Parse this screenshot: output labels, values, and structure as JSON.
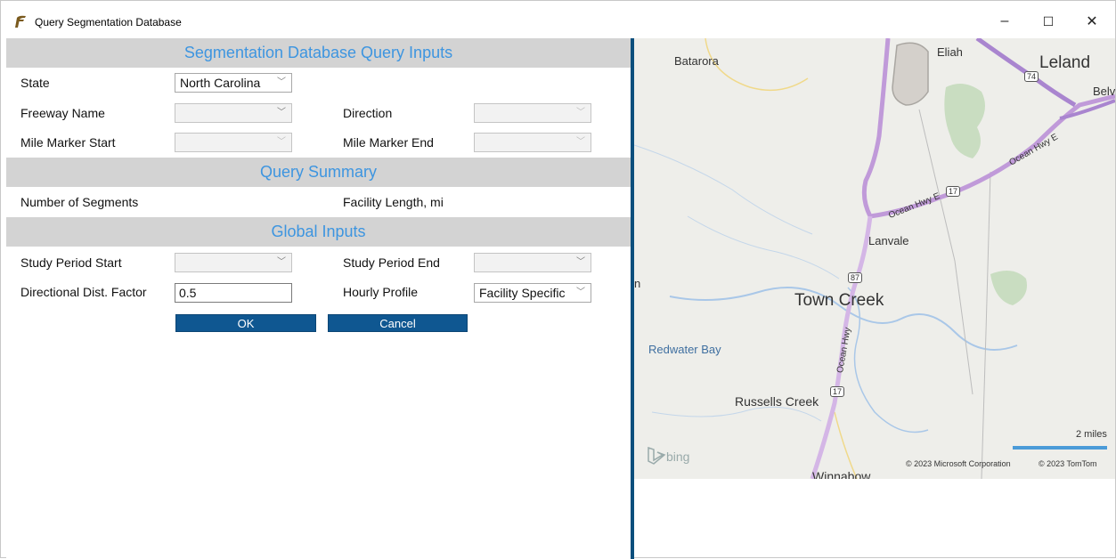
{
  "window": {
    "title": "Query Segmentation Database",
    "minimize": "–",
    "maximize": "☐",
    "close": "✕"
  },
  "sections": {
    "inputs": "Segmentation Database Query Inputs",
    "summary": "Query Summary",
    "global": "Global Inputs"
  },
  "fields": {
    "state_label": "State",
    "state_value": "North Carolina",
    "freeway_label": "Freeway Name",
    "freeway_value": "",
    "direction_label": "Direction",
    "direction_value": "",
    "mm_start_label": "Mile Marker Start",
    "mm_start_value": "",
    "mm_end_label": "Mile Marker End",
    "mm_end_value": "",
    "num_segments_label": "Number of Segments",
    "facility_length_label": "Facility Length, mi",
    "study_start_label": "Study Period Start",
    "study_start_value": "",
    "study_end_label": "Study Period End",
    "study_end_value": "",
    "ddf_label": "Directional Dist. Factor",
    "ddf_value": "0.5",
    "hourly_label": "Hourly Profile",
    "hourly_value": "Facility Specific"
  },
  "buttons": {
    "ok": "OK",
    "cancel": "Cancel"
  },
  "map": {
    "places": {
      "batarora": "Batarora",
      "eliah": "Eliah",
      "leland": "Leland",
      "belv": "Belv",
      "lanvale": "Lanvale",
      "town_creek": "Town Creek",
      "redwater_bay": "Redwater Bay",
      "russells_creek": "Russells Creek",
      "winnabow": "Winnabow",
      "n": "n"
    },
    "roads": {
      "ocean_hwy_e_1": "Ocean Hwy E",
      "ocean_hwy_e_2": "Ocean Hwy E",
      "ocean_hwy": "Ocean Hwy",
      "shield_74": "74",
      "shield_17a": "17",
      "shield_87": "87",
      "shield_17b": "17"
    },
    "scale": "2 miles",
    "copyright_ms": "© 2023 Microsoft Corporation",
    "copyright_tt": "© 2023 TomTom",
    "bing": "bing"
  }
}
